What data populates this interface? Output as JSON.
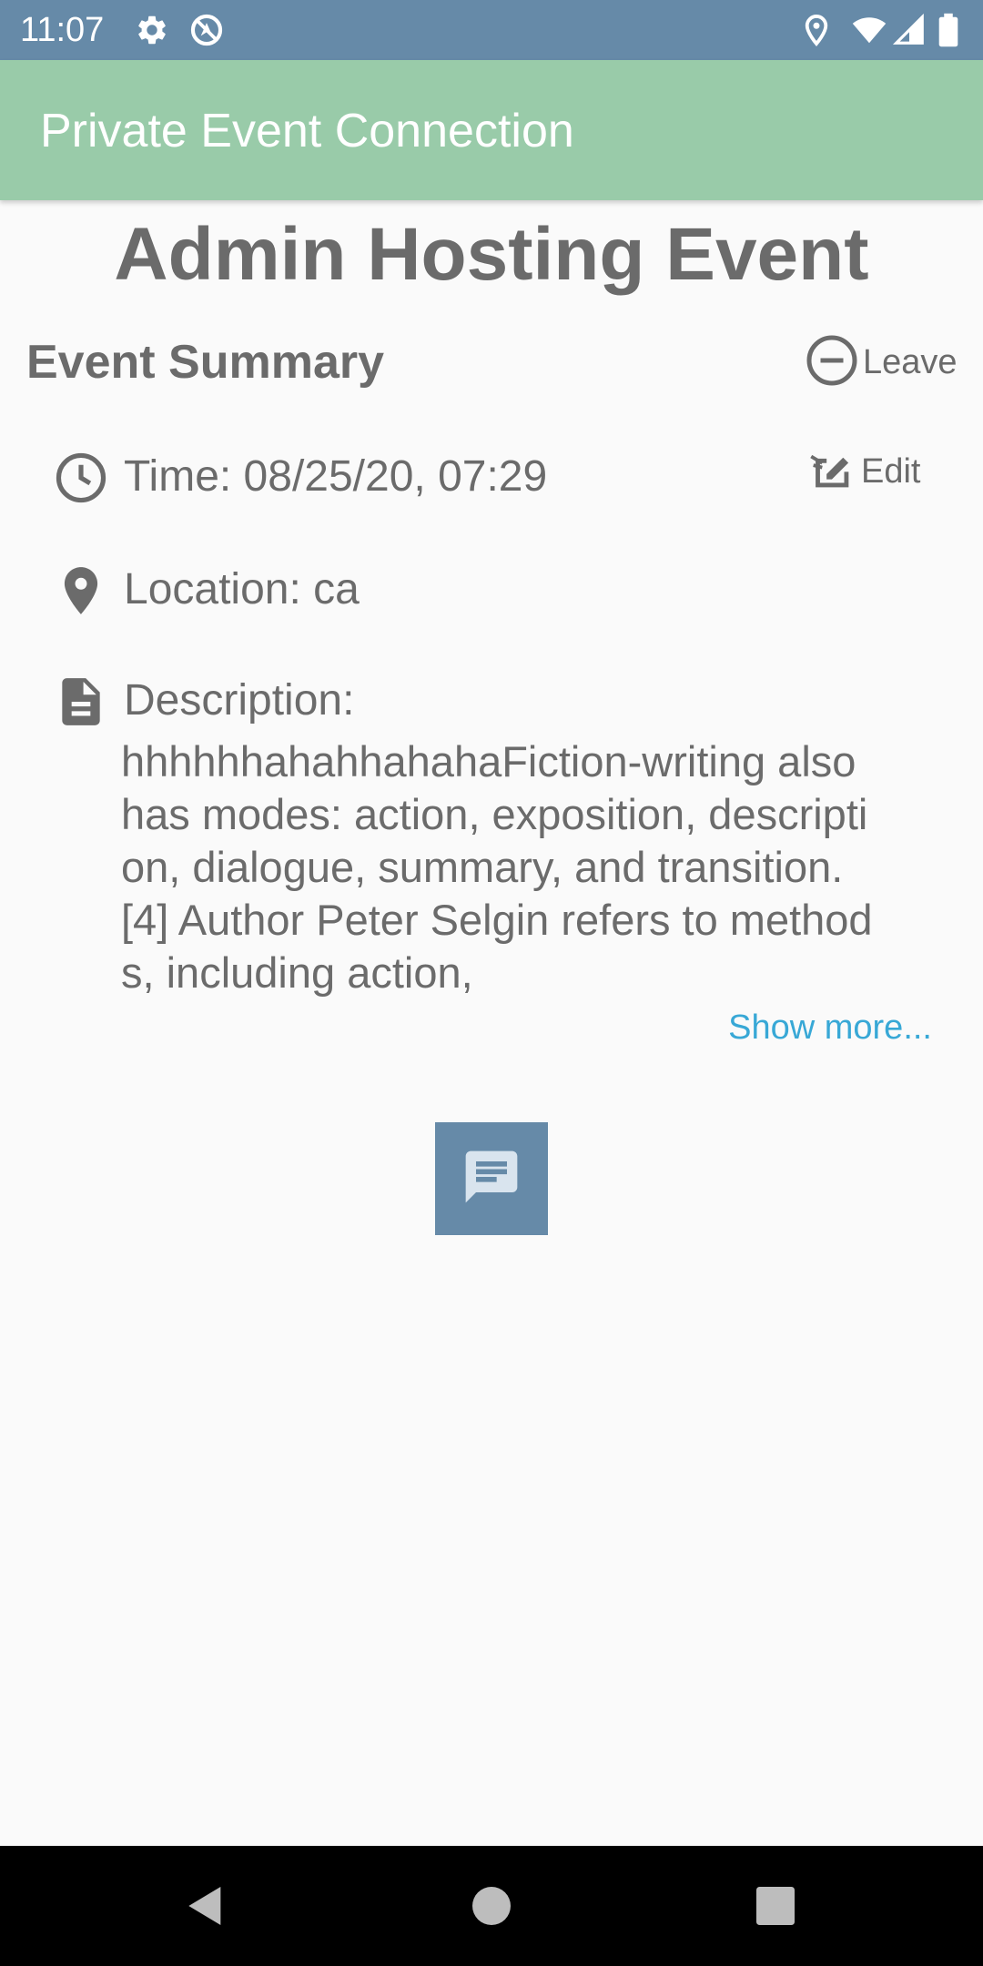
{
  "status_bar": {
    "time": "11:07",
    "left_icons": [
      "gear-icon",
      "no-location-sharing-icon"
    ],
    "right_icons": [
      "location-icon",
      "wifi-icon",
      "cell-signal-icon",
      "battery-icon"
    ],
    "color": "#668aa8"
  },
  "app_bar": {
    "title": "Private Event Connection",
    "color": "#99cba9"
  },
  "event": {
    "title": "Admin Hosting Event"
  },
  "summary": {
    "heading": "Event Summary",
    "leave_label": "Leave",
    "edit_label": "Edit",
    "time_text": "Time: 08/25/20, 07:29",
    "location_text": "Location: ca",
    "description_label": "Description:",
    "description_text": "hhhhhhahahhahahaFiction-writing also has modes: action, exposition, description, dialogue, summary, and transition.[4] Author Peter Selgin refers to methods, including action,",
    "show_more_label": "Show more...",
    "link_color": "#38a8d6"
  },
  "chat_button": {
    "icon": "chat-message-icon",
    "color": "#668aa8"
  },
  "nav_bar": {
    "icons": [
      "back-icon",
      "home-icon",
      "recents-icon"
    ]
  }
}
